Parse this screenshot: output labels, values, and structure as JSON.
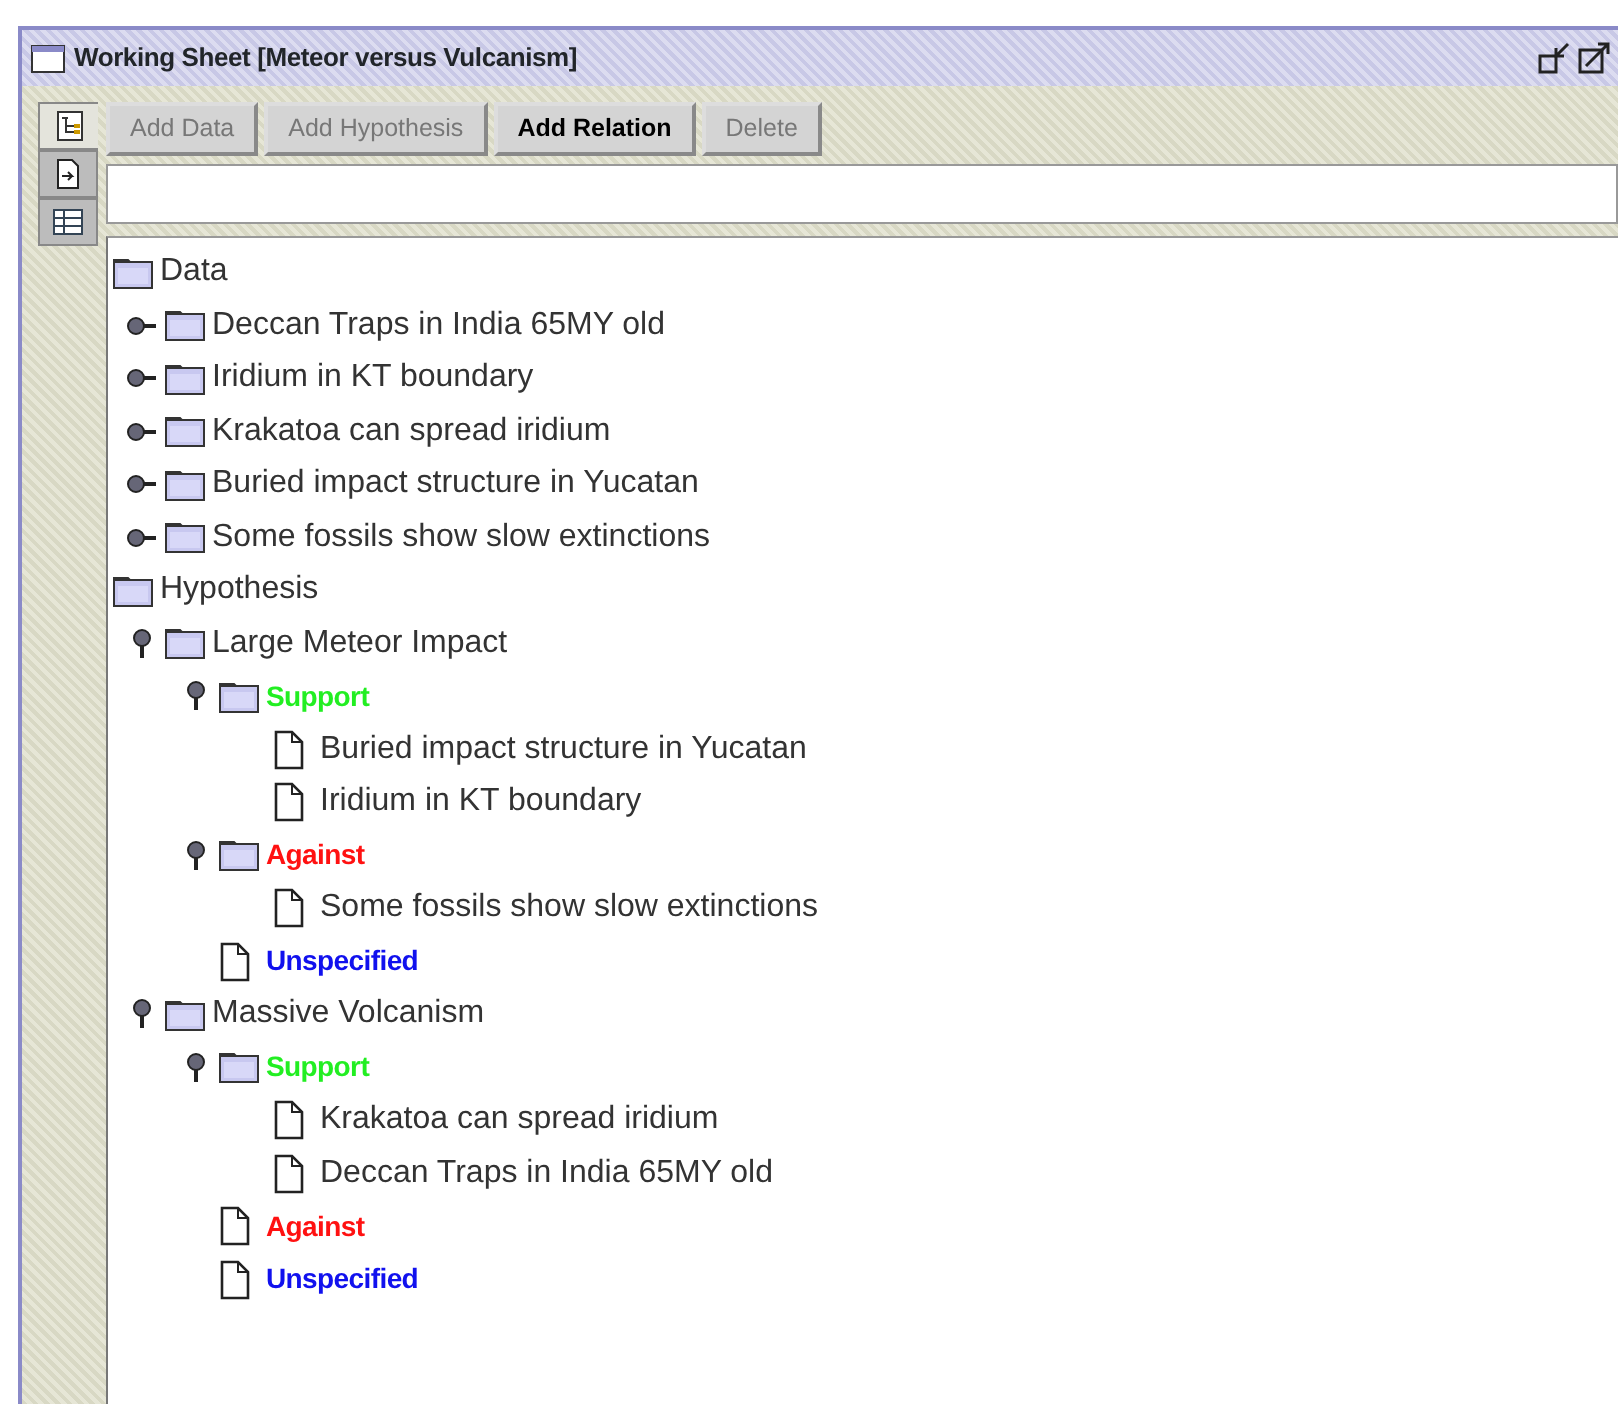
{
  "window": {
    "title": "Working Sheet [Meteor versus Vulcanism]"
  },
  "side_tabs": [
    {
      "selected": true
    },
    {
      "selected": false
    },
    {
      "selected": false
    }
  ],
  "toolbar": [
    {
      "label": "Add Data",
      "disabled": true
    },
    {
      "label": "Add Hypothesis",
      "disabled": true
    },
    {
      "label": "Add Relation",
      "disabled": false
    },
    {
      "label": "Delete",
      "disabled": true
    }
  ],
  "tree": [
    {
      "label": "Data",
      "kind": "folder",
      "children": [
        {
          "label": "Deccan Traps in India 65MY old",
          "kind": "folder",
          "expanded": false
        },
        {
          "label": "Iridium in KT boundary",
          "kind": "folder",
          "expanded": false
        },
        {
          "label": "Krakatoa can spread iridium",
          "kind": "folder",
          "expanded": false
        },
        {
          "label": "Buried impact structure in Yucatan",
          "kind": "folder",
          "expanded": false
        },
        {
          "label": "Some fossils show slow extinctions",
          "kind": "folder",
          "expanded": false
        }
      ]
    },
    {
      "label": "Hypothesis",
      "kind": "folder",
      "children": [
        {
          "label": "Large Meteor Impact",
          "kind": "folder",
          "expanded": true,
          "children": [
            {
              "label": "Support",
              "kind": "folder",
              "expanded": true,
              "color": "#22ee22",
              "children": [
                {
                  "label": "Buried impact structure in Yucatan",
                  "kind": "document"
                },
                {
                  "label": "Iridium in KT boundary",
                  "kind": "document"
                }
              ]
            },
            {
              "label": "Against",
              "kind": "folder",
              "expanded": true,
              "color": "#ff1111",
              "children": [
                {
                  "label": "Some fossils show slow extinctions",
                  "kind": "document"
                }
              ]
            },
            {
              "label": "Unspecified",
              "kind": "document",
              "color": "#1111ee"
            }
          ]
        },
        {
          "label": "Massive Volcanism",
          "kind": "folder",
          "expanded": true,
          "children": [
            {
              "label": "Support",
              "kind": "folder",
              "expanded": true,
              "color": "#22ee22",
              "children": [
                {
                  "label": "Krakatoa can spread iridium",
                  "kind": "document"
                },
                {
                  "label": "Deccan Traps in India 65MY old",
                  "kind": "document"
                }
              ]
            },
            {
              "label": "Against",
              "kind": "document",
              "color": "#ff1111"
            },
            {
              "label": "Unspecified",
              "kind": "document",
              "color": "#1111ee"
            }
          ]
        }
      ]
    }
  ]
}
